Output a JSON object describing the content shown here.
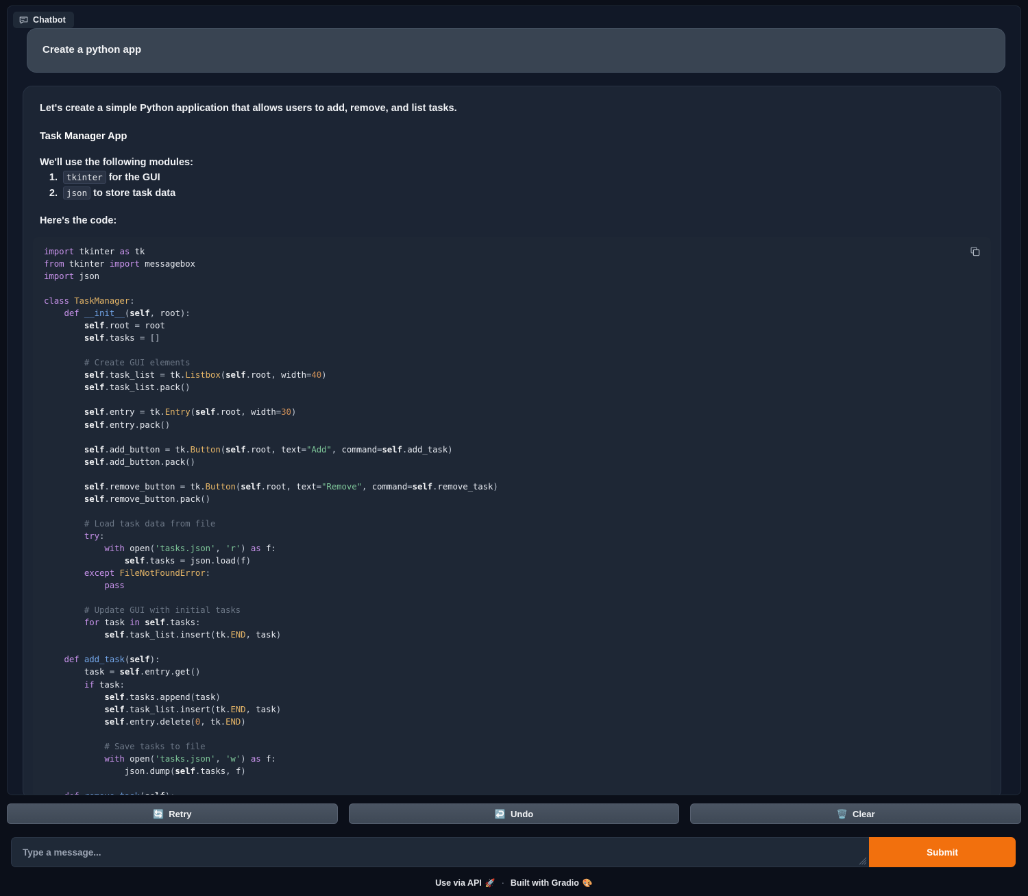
{
  "chatbot": {
    "tab_label": "Chatbot",
    "tab_icon": "chat-bubble-icon"
  },
  "messages": {
    "user": {
      "text": "Create a python app"
    },
    "bot": {
      "intro": "Let's create a simple Python application that allows users to add, remove, and list tasks.",
      "heading": "Task Manager App",
      "modules_lead": "We'll use the following modules:",
      "modules": [
        {
          "code": "tkinter",
          "text": " for the GUI"
        },
        {
          "code": "json",
          "text": " to store task data"
        }
      ],
      "code_lead": "Here's the code:",
      "copy_icon": "copy-icon"
    }
  },
  "code_block": {
    "language": "python",
    "text": "import tkinter as tk\nfrom tkinter import messagebox\nimport json\n\nclass TaskManager:\n    def __init__(self, root):\n        self.root = root\n        self.tasks = []\n\n        # Create GUI elements\n        self.task_list = tk.Listbox(self.root, width=40)\n        self.task_list.pack()\n\n        self.entry = tk.Entry(self.root, width=30)\n        self.entry.pack()\n\n        self.add_button = tk.Button(self.root, text=\"Add\", command=self.add_task)\n        self.add_button.pack()\n\n        self.remove_button = tk.Button(self.root, text=\"Remove\", command=self.remove_task)\n        self.remove_button.pack()\n\n        # Load task data from file\n        try:\n            with open('tasks.json', 'r') as f:\n                self.tasks = json.load(f)\n        except FileNotFoundError:\n            pass\n\n        # Update GUI with initial tasks\n        for task in self.tasks:\n            self.task_list.insert(tk.END, task)\n\n    def add_task(self):\n        task = self.entry.get()\n        if task:\n            self.tasks.append(task)\n            self.task_list.insert(tk.END, task)\n            self.entry.delete(0, tk.END)\n\n            # Save tasks to file\n            with open('tasks.json', 'w') as f:\n                json.dump(self.tasks, f)\n\n    def remove_task(self):"
  },
  "actions": [
    {
      "label": "Retry",
      "emoji": "🔄",
      "icon": "retry-icon"
    },
    {
      "label": "Undo",
      "emoji": "↩️",
      "icon": "undo-icon"
    },
    {
      "label": "Clear",
      "emoji": "🗑️",
      "icon": "trash-icon"
    }
  ],
  "input": {
    "placeholder": "Type a message...",
    "value": "",
    "submit_label": "Submit",
    "submit_color": "#f2700d"
  },
  "footer": {
    "api_label": "Use via API",
    "api_emoji": "🚀",
    "separator": "·",
    "built_label": "Built with Gradio",
    "built_emoji": "🎨"
  }
}
